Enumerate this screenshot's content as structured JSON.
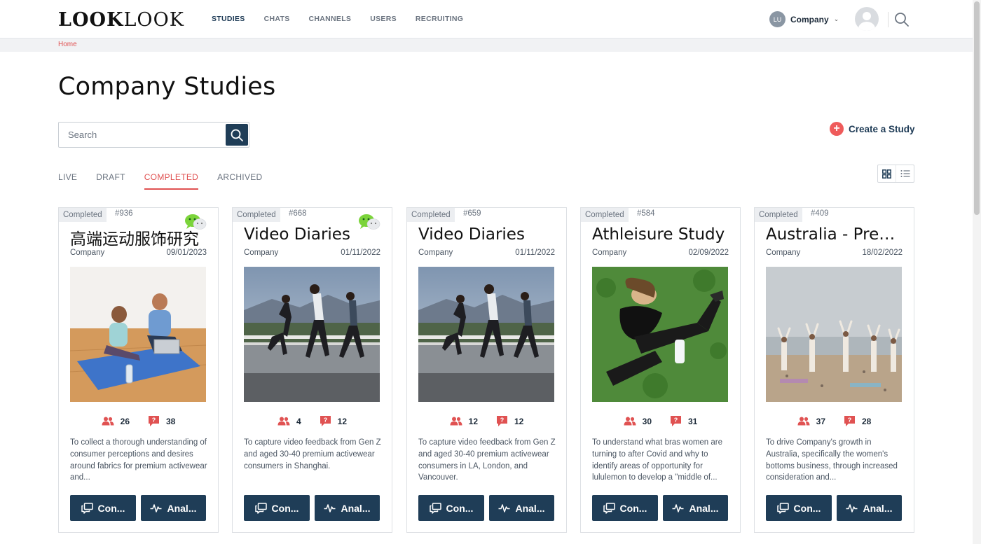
{
  "header": {
    "logo_bold": "LOOK",
    "logo_thin": "LOOK",
    "nav": [
      "STUDIES",
      "CHATS",
      "CHANNELS",
      "USERS",
      "RECRUITING"
    ],
    "active_nav": "STUDIES",
    "company_initials": "LU",
    "company_name": "Company"
  },
  "breadcrumb": "Home",
  "page_title": "Company Studies",
  "search": {
    "placeholder": "Search"
  },
  "create_study_label": "Create a Study",
  "tabs": [
    "LIVE",
    "DRAFT",
    "COMPLETED",
    "ARCHIVED"
  ],
  "active_tab": "COMPLETED",
  "cards": [
    {
      "status": "Completed",
      "id": "#936",
      "wechat": true,
      "title": "高端运动服饰研究",
      "company": "Company",
      "date": "09/01/2023",
      "participants": "26",
      "questions": "38",
      "description": "To collect a thorough understanding of consumer perceptions and desires around fabrics for premium activewear and...",
      "btn1": "Con...",
      "btn2": "Anal...",
      "image": "couple-yoga-mat"
    },
    {
      "status": "Completed",
      "id": "#668",
      "wechat": true,
      "title": "Video Diaries",
      "company": "Company",
      "date": "01/11/2022",
      "participants": "4",
      "questions": "12",
      "description": "To capture video feedback from Gen Z and aged 30-40 premium activewear consumers in Shanghai.",
      "btn1": "Con...",
      "btn2": "Anal...",
      "image": "runners-road"
    },
    {
      "status": "Completed",
      "id": "#659",
      "wechat": false,
      "title": "Video Diaries",
      "company": "Company",
      "date": "01/11/2022",
      "participants": "12",
      "questions": "12",
      "description": "To capture video feedback from Gen Z and aged 30-40 premium activewear consumers in LA, London, and Vancouver.",
      "btn1": "Con...",
      "btn2": "Anal...",
      "image": "runners-road"
    },
    {
      "status": "Completed",
      "id": "#584",
      "wechat": false,
      "title": "Athleisure Study",
      "company": "Company",
      "date": "02/09/2022",
      "participants": "30",
      "questions": "31",
      "description": "To understand what bras women are turning to after Covid and why to identify areas of opportunity for lululemon to develop a \"middle of...",
      "btn1": "Con...",
      "btn2": "Anal...",
      "image": "woman-stretching-grass"
    },
    {
      "status": "Completed",
      "id": "#409",
      "wechat": false,
      "title": "Australia - Premium Activewear",
      "company": "Company",
      "date": "18/02/2022",
      "participants": "37",
      "questions": "28",
      "description": "To drive Company's growth in Australia, specifically the women's bottoms business, through increased consideration and...",
      "btn1": "Con...",
      "btn2": "Anal...",
      "image": "beach-yoga-group"
    }
  ]
}
